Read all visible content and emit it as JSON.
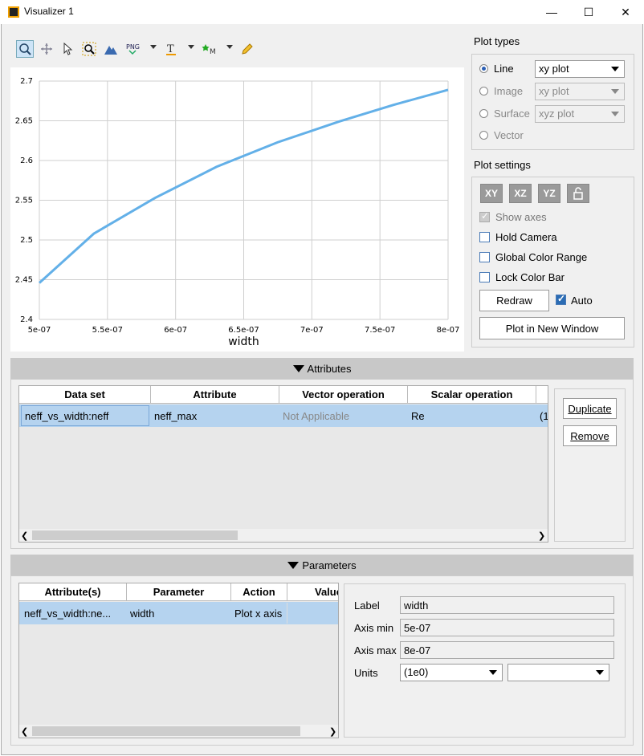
{
  "window": {
    "title": "Visualizer 1",
    "minimize": "—",
    "maximize": "☐",
    "close": "✕"
  },
  "toolbar": {
    "icons": [
      "zoom-icon",
      "pan-icon",
      "select-icon",
      "zoom-box-icon",
      "mountain-icon",
      "png-export-icon",
      "text-icon",
      "marker-icon",
      "pencil-icon"
    ]
  },
  "chart_data": {
    "type": "line",
    "xlabel": "width",
    "x": [
      5e-07,
      5.4e-07,
      5.85e-07,
      6.3e-07,
      6.75e-07,
      7.2e-07,
      7.6e-07,
      8e-07
    ],
    "values": [
      2.446,
      2.508,
      2.553,
      2.592,
      2.623,
      2.649,
      2.67,
      2.689
    ],
    "xlim": [
      5e-07,
      8e-07
    ],
    "ylim": [
      2.4,
      2.7
    ],
    "xticks": [
      "5e-07",
      "5.5e-07",
      "6e-07",
      "6.5e-07",
      "7e-07",
      "7.5e-07",
      "8e-07"
    ],
    "yticks": [
      "2.4",
      "2.45",
      "2.5",
      "2.55",
      "2.6",
      "2.65",
      "2.7"
    ],
    "grid": true,
    "color": "#63b0e8"
  },
  "plot_types": {
    "title": "Plot types",
    "options": [
      {
        "label": "Line",
        "combo": "xy plot",
        "checked": true,
        "enabled": true
      },
      {
        "label": "Image",
        "combo": "xy plot",
        "checked": false,
        "enabled": false
      },
      {
        "label": "Surface",
        "combo": "xyz plot",
        "checked": false,
        "enabled": false
      },
      {
        "label": "Vector",
        "combo": "",
        "checked": false,
        "enabled": false
      }
    ]
  },
  "plot_settings": {
    "title": "Plot settings",
    "axis_buttons": [
      "XY",
      "XZ",
      "YZ"
    ],
    "show_axes": "Show axes",
    "hold_camera": "Hold Camera",
    "global_color_range": "Global Color Range",
    "lock_color_bar": "Lock Color Bar",
    "redraw": "Redraw",
    "auto": "Auto",
    "plot_new_window": "Plot in New Window"
  },
  "attributes": {
    "header": "Attributes",
    "columns": [
      "Data set",
      "Attribute",
      "Vector operation",
      "Scalar operation"
    ],
    "rows": [
      {
        "dataset": "neff_vs_width:neff",
        "attribute": "neff_max",
        "vector_op": "Not Applicable",
        "scalar_op": "Re",
        "extra": "(1"
      }
    ],
    "duplicate": "Duplicate",
    "remove": "Remove"
  },
  "parameters": {
    "header": "Parameters",
    "columns": [
      "Attribute(s)",
      "Parameter",
      "Action",
      "Value"
    ],
    "rows": [
      {
        "attribute": "neff_vs_width:ne...",
        "parameter": "width",
        "action": "Plot x axis",
        "value": ""
      }
    ],
    "fields": {
      "label_label": "Label",
      "label_value": "width",
      "axis_min_label": "Axis min",
      "axis_min_value": "5e-07",
      "axis_max_label": "Axis max",
      "axis_max_value": "8e-07",
      "units_label": "Units",
      "units_value": "(1e0)",
      "units2_value": ""
    }
  }
}
